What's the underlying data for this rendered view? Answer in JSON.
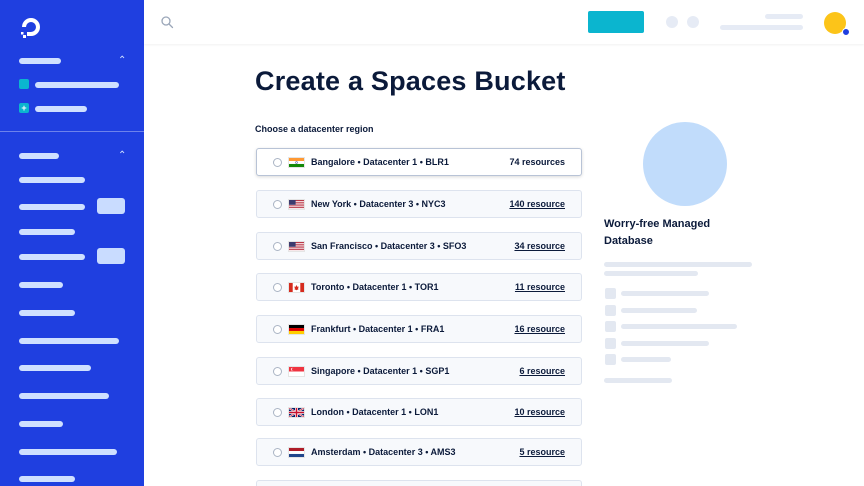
{
  "page": {
    "title": "Create a Spaces Bucket",
    "region_label": "Choose a datacenter region"
  },
  "regions": [
    {
      "label": "Bangalore • Datacenter 1 • BLR1",
      "count": "74 resources",
      "flag": "india-flag-icon",
      "selected": true
    },
    {
      "label": "New York • Datacenter 3 • NYC3",
      "count": "140 resource",
      "flag": "usa-flag-icon"
    },
    {
      "label": "San Francisco • Datacenter 3 • SFO3",
      "count": "34 resource",
      "flag": "usa-flag-icon"
    },
    {
      "label": "Toronto • Datacenter 1 • TOR1",
      "count": "11 resource",
      "flag": "canada-flag-icon"
    },
    {
      "label": "Frankfurt • Datacenter 1 • FRA1",
      "count": "16 resource",
      "flag": "germany-flag-icon"
    },
    {
      "label": "Singapore • Datacenter 1 • SGP1",
      "count": "6 resource",
      "flag": "singapore-flag-icon"
    },
    {
      "label": "London • Datacenter 1 • LON1",
      "count": "10 resource",
      "flag": "uk-flag-icon"
    },
    {
      "label": "Amsterdam • Datacenter 3 • AMS3",
      "count": "5 resource",
      "flag": "netherlands-flag-icon"
    }
  ],
  "promo": {
    "title": "Worry-free Managed Database"
  },
  "colors": {
    "sidebar": "#1f3fe0",
    "cta": "#0bb5cf",
    "avatar": "#fcc419",
    "promo_circle": "#c1dcfb"
  },
  "icons": {
    "logo": "digitalocean-logo-icon",
    "search": "search-icon"
  }
}
